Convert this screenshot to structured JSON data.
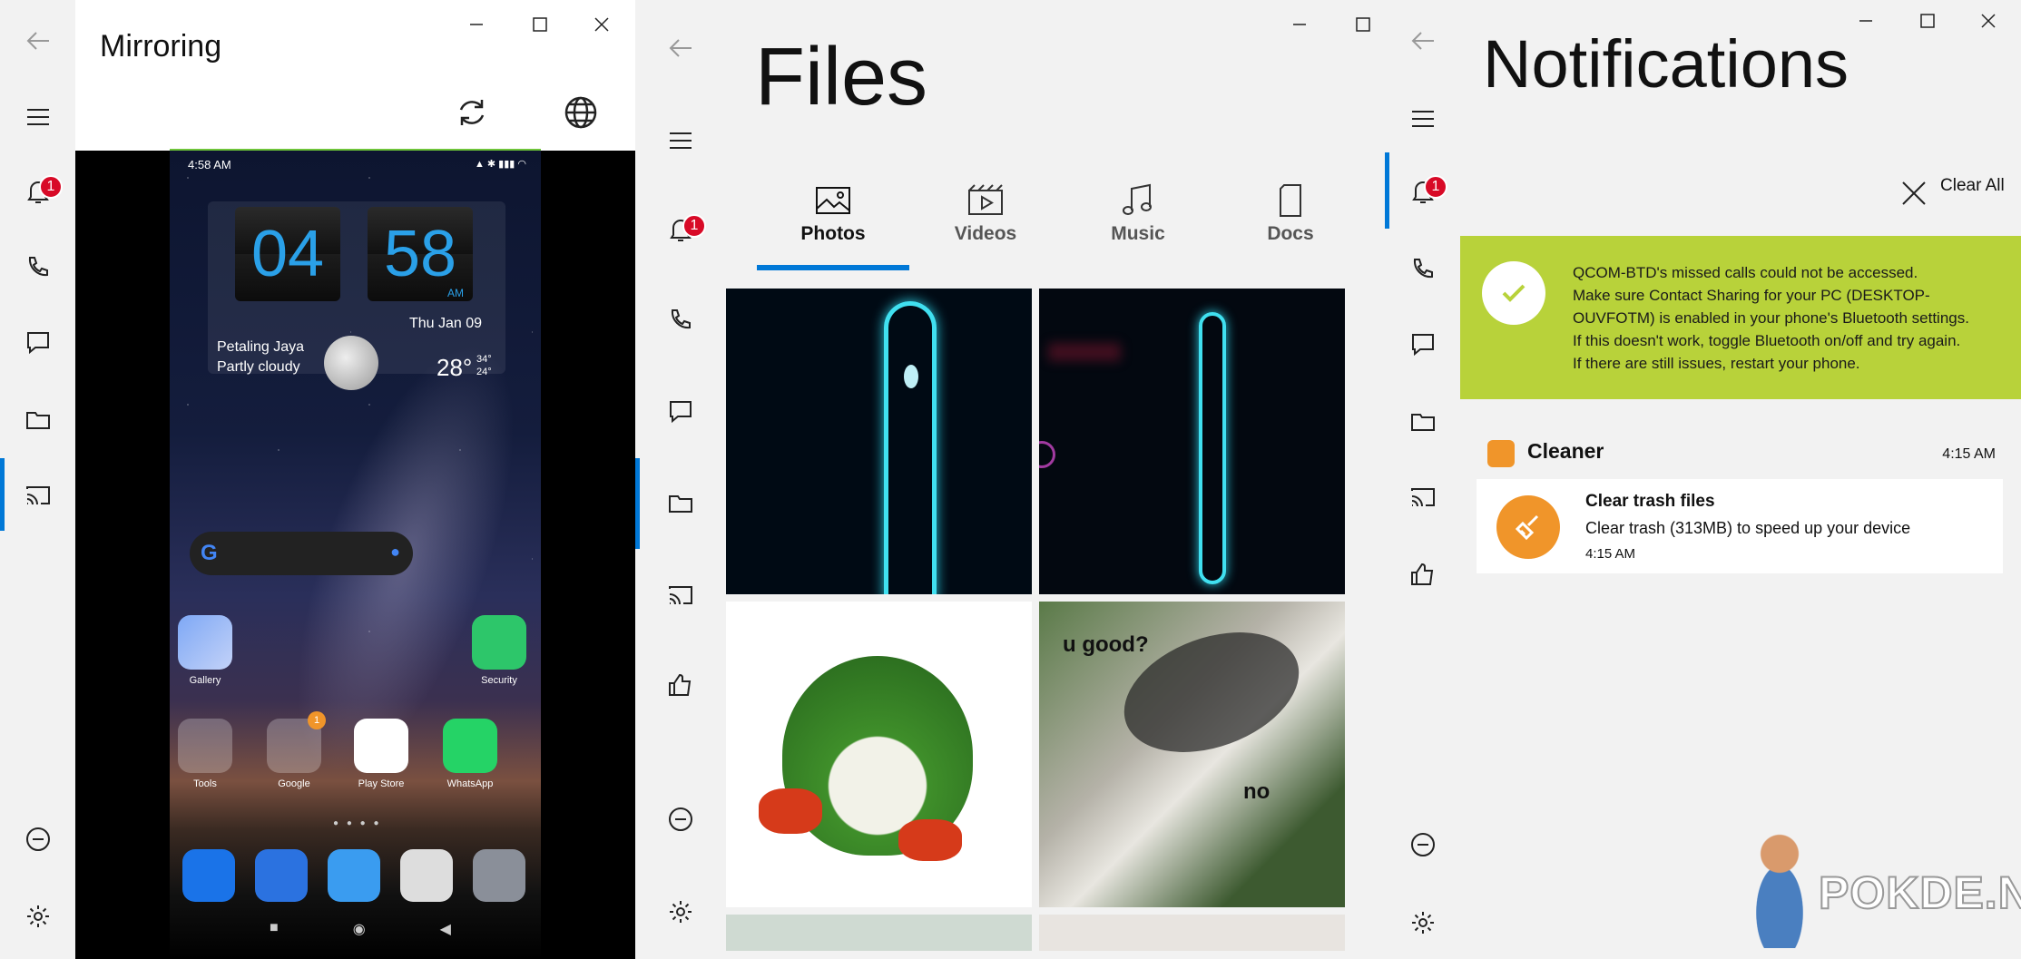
{
  "mirroring": {
    "title": "Mirroring",
    "refresh_icon": "refresh-icon",
    "globe_icon": "globe-icon",
    "phone": {
      "status_time": "4:58 AM",
      "clock_hour": "04",
      "clock_minute": "58",
      "clock_ampm": "AM",
      "date": "Thu Jan 09",
      "city": "Petaling Jaya",
      "weather": "Partly cloudy",
      "temp": "28°",
      "temp_hi": "34°",
      "temp_lo": "24°",
      "apps_row1": [
        {
          "label": "Gallery"
        },
        {
          "label": "Security"
        }
      ],
      "apps_row2": [
        {
          "label": "Tools"
        },
        {
          "label": "Google"
        },
        {
          "label": "Play Store"
        },
        {
          "label": "WhatsApp"
        }
      ],
      "google_badge": "1"
    }
  },
  "files": {
    "title": "Files",
    "tabs": [
      {
        "label": "Photos",
        "icon": "photo-icon"
      },
      {
        "label": "Videos",
        "icon": "video-icon"
      },
      {
        "label": "Music",
        "icon": "music-icon"
      },
      {
        "label": "Docs",
        "icon": "doc-icon"
      }
    ],
    "meme_text_1": "u good?",
    "meme_text_2": "no"
  },
  "notifications": {
    "title": "Notifications",
    "clear_all": "Clear All",
    "banner": {
      "line1": "QCOM-BTD's missed calls could not be accessed.",
      "line2": "Make sure Contact Sharing for your PC (DESKTOP-",
      "line3": "OUVFOTM) is enabled in your phone's Bluetooth settings.",
      "line4": "If this doesn't work, toggle Bluetooth on/off and try again.",
      "line5": "If there are still issues, restart your phone.",
      "color": "#b8d23a"
    },
    "app_name": "Cleaner",
    "app_time": "4:15 AM",
    "item_title": "Clear trash files",
    "item_body": "Clear trash (313MB) to speed up your device",
    "item_time": "4:15 AM"
  },
  "sidebar": {
    "notification_badge": "1"
  },
  "watermark": "POKDE.NET",
  "colors": {
    "accent": "#0078d7",
    "badge": "#d80a27",
    "banner": "#b8d23a",
    "cleaner": "#f0952a"
  }
}
